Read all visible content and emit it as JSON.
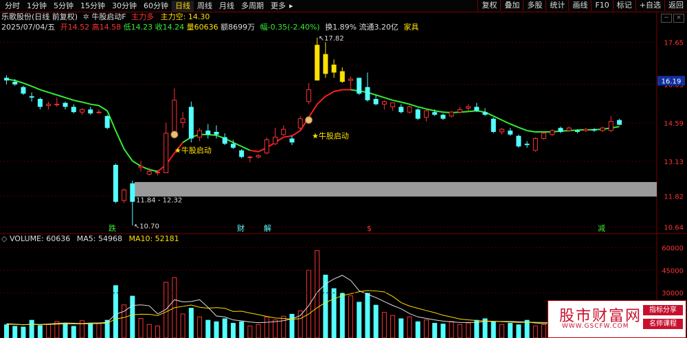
{
  "toolbar": {
    "periods": [
      "分时",
      "1分钟",
      "5分钟",
      "15分钟",
      "30分钟",
      "60分钟",
      "日线",
      "周线",
      "月线",
      "多周期",
      "更多"
    ],
    "active_index": 6,
    "more_caret": "▸",
    "right_buttons": [
      "复权",
      "叠加",
      "多股",
      "统计",
      "画线",
      "F10",
      "标记",
      "+自选",
      "返回"
    ]
  },
  "header": {
    "stock_name": "乐歌股份(日线 前复权)",
    "indicator_name": "牛股启动F",
    "zlduo": "主力多",
    "zlkong": "主力空: 14.30"
  },
  "quote": {
    "date": "2025/07/04/五",
    "open": "开14.52",
    "high": "高14.58",
    "low": "低14.23",
    "close": "收14.24",
    "volume": "量60636",
    "amount": "额8699万",
    "change": "幅-0.35(-2.40%)",
    "turnover": "换1.89%",
    "float_cap": "流通3.20亿",
    "sector": "家具"
  },
  "price_axis": [
    "17.65",
    "16.05",
    "14.59",
    "13.13",
    "11.82",
    "10.64"
  ],
  "current_price_tag": "16.19",
  "annotations": {
    "high_label": "17.82",
    "low_label": "10.70",
    "range_label": "11.84 - 12.32",
    "signal_1": "★牛股启动",
    "signal_2": "★牛股启动",
    "event_1": "跌",
    "event_2": "财",
    "event_3": "解",
    "event_4": "$",
    "event_5": "减"
  },
  "volume": {
    "label": "VOLUME: 60636",
    "ma5": "MA5: 54968",
    "ma10": "MA10: 52181",
    "axis": [
      "60000",
      "45000",
      "30000"
    ]
  },
  "colors": {
    "up": "#ff3333",
    "down": "#54ffff",
    "ma_green": "#33ee33",
    "ma_red": "#ff2020",
    "yellow": "#ffe000",
    "grey_band": "#9a9a9a"
  },
  "watermark": {
    "title": "股市财富网",
    "url": "WWW.GSCFW.COM",
    "tag1": "指标分享",
    "tag2": "名师课程"
  },
  "chart_data": {
    "type": "candlestick",
    "ylim": [
      10.5,
      18.0
    ],
    "candles": [
      {
        "o": 16.3,
        "h": 16.4,
        "l": 16.05,
        "c": 16.2
      },
      {
        "o": 16.15,
        "h": 16.25,
        "l": 16.0,
        "c": 16.05
      },
      {
        "o": 15.95,
        "h": 16.0,
        "l": 15.65,
        "c": 15.7
      },
      {
        "o": 15.6,
        "h": 15.75,
        "l": 15.4,
        "c": 15.55
      },
      {
        "o": 15.5,
        "h": 15.55,
        "l": 15.1,
        "c": 15.2
      },
      {
        "o": 15.25,
        "h": 15.4,
        "l": 15.1,
        "c": 15.3
      },
      {
        "o": 15.3,
        "h": 15.55,
        "l": 15.2,
        "c": 15.3
      },
      {
        "o": 15.35,
        "h": 15.4,
        "l": 15.1,
        "c": 15.2
      },
      {
        "o": 15.2,
        "h": 15.3,
        "l": 14.95,
        "c": 15.0
      },
      {
        "o": 15.0,
        "h": 15.15,
        "l": 14.9,
        "c": 15.1
      },
      {
        "o": 15.1,
        "h": 15.2,
        "l": 14.9,
        "c": 14.95
      },
      {
        "o": 15.0,
        "h": 15.1,
        "l": 14.95,
        "c": 15.0
      },
      {
        "o": 14.85,
        "h": 14.9,
        "l": 14.35,
        "c": 14.4
      },
      {
        "o": 13.0,
        "h": 13.05,
        "l": 11.55,
        "c": 11.6
      },
      {
        "o": 11.65,
        "h": 12.1,
        "l": 11.55,
        "c": 12.05
      },
      {
        "o": 12.3,
        "h": 12.4,
        "l": 10.7,
        "c": 11.6
      },
      {
        "o": 12.9,
        "h": 13.15,
        "l": 12.75,
        "c": 12.95
      },
      {
        "o": 12.65,
        "h": 12.9,
        "l": 12.6,
        "c": 12.75
      },
      {
        "o": 12.7,
        "h": 12.8,
        "l": 12.6,
        "c": 12.72
      },
      {
        "o": 12.7,
        "h": 14.6,
        "l": 12.7,
        "c": 14.2
      },
      {
        "o": 14.2,
        "h": 15.9,
        "l": 14.1,
        "c": 15.45
      },
      {
        "o": 14.6,
        "h": 15.0,
        "l": 14.4,
        "c": 14.75
      },
      {
        "o": 15.2,
        "h": 15.4,
        "l": 13.85,
        "c": 14.0
      },
      {
        "o": 14.05,
        "h": 14.4,
        "l": 13.9,
        "c": 14.3
      },
      {
        "o": 14.3,
        "h": 14.55,
        "l": 14.0,
        "c": 14.15
      },
      {
        "o": 14.25,
        "h": 14.5,
        "l": 14.0,
        "c": 14.15
      },
      {
        "o": 14.05,
        "h": 14.2,
        "l": 13.75,
        "c": 13.8
      },
      {
        "o": 13.8,
        "h": 13.95,
        "l": 13.6,
        "c": 13.65
      },
      {
        "o": 13.55,
        "h": 13.6,
        "l": 13.25,
        "c": 13.3
      },
      {
        "o": 13.3,
        "h": 13.35,
        "l": 13.1,
        "c": 13.3
      },
      {
        "o": 13.3,
        "h": 13.4,
        "l": 13.25,
        "c": 13.35
      },
      {
        "o": 13.45,
        "h": 14.05,
        "l": 13.4,
        "c": 13.95
      },
      {
        "o": 13.8,
        "h": 14.4,
        "l": 13.75,
        "c": 14.05
      },
      {
        "o": 14.15,
        "h": 14.5,
        "l": 14.1,
        "c": 14.35
      },
      {
        "o": 14.0,
        "h": 14.1,
        "l": 13.75,
        "c": 13.85
      },
      {
        "o": 14.4,
        "h": 14.85,
        "l": 14.3,
        "c": 14.75
      },
      {
        "o": 15.4,
        "h": 16.1,
        "l": 15.3,
        "c": 15.85
      },
      {
        "o": 16.2,
        "h": 17.82,
        "l": 16.2,
        "c": 17.55
      },
      {
        "o": 17.2,
        "h": 17.65,
        "l": 16.3,
        "c": 16.45
      },
      {
        "o": 16.8,
        "h": 17.0,
        "l": 16.3,
        "c": 16.5
      },
      {
        "o": 16.55,
        "h": 16.7,
        "l": 16.1,
        "c": 16.15
      },
      {
        "o": 16.2,
        "h": 16.35,
        "l": 15.85,
        "c": 16.25
      },
      {
        "o": 16.3,
        "h": 16.3,
        "l": 15.65,
        "c": 15.7
      },
      {
        "o": 15.95,
        "h": 16.5,
        "l": 15.4,
        "c": 15.45
      },
      {
        "o": 15.5,
        "h": 15.65,
        "l": 15.25,
        "c": 15.3
      },
      {
        "o": 15.3,
        "h": 15.45,
        "l": 15.1,
        "c": 15.4
      },
      {
        "o": 15.2,
        "h": 15.35,
        "l": 15.05,
        "c": 15.35
      },
      {
        "o": 15.2,
        "h": 15.3,
        "l": 14.95,
        "c": 15.0
      },
      {
        "o": 15.0,
        "h": 15.25,
        "l": 14.95,
        "c": 15.2
      },
      {
        "o": 15.1,
        "h": 15.15,
        "l": 14.7,
        "c": 14.75
      },
      {
        "o": 14.8,
        "h": 15.1,
        "l": 14.65,
        "c": 15.05
      },
      {
        "o": 15.0,
        "h": 15.1,
        "l": 14.85,
        "c": 14.9
      },
      {
        "o": 14.9,
        "h": 14.95,
        "l": 14.7,
        "c": 14.75
      },
      {
        "o": 14.85,
        "h": 15.05,
        "l": 14.8,
        "c": 15.0
      },
      {
        "o": 15.0,
        "h": 15.2,
        "l": 14.95,
        "c": 15.1
      },
      {
        "o": 15.15,
        "h": 15.3,
        "l": 15.05,
        "c": 15.2
      },
      {
        "o": 15.2,
        "h": 15.35,
        "l": 15.0,
        "c": 15.05
      },
      {
        "o": 15.0,
        "h": 15.15,
        "l": 14.85,
        "c": 14.9
      },
      {
        "o": 14.75,
        "h": 14.8,
        "l": 14.2,
        "c": 14.25
      },
      {
        "o": 14.25,
        "h": 14.4,
        "l": 14.15,
        "c": 14.35
      },
      {
        "o": 14.3,
        "h": 14.4,
        "l": 14.1,
        "c": 14.15
      },
      {
        "o": 14.1,
        "h": 14.15,
        "l": 13.65,
        "c": 13.7
      },
      {
        "o": 13.8,
        "h": 13.9,
        "l": 13.65,
        "c": 13.75
      },
      {
        "o": 13.55,
        "h": 14.05,
        "l": 13.5,
        "c": 14.0
      },
      {
        "o": 14.0,
        "h": 14.25,
        "l": 13.95,
        "c": 14.2
      },
      {
        "o": 14.15,
        "h": 14.35,
        "l": 14.1,
        "c": 14.3
      },
      {
        "o": 14.4,
        "h": 14.45,
        "l": 14.2,
        "c": 14.25
      },
      {
        "o": 14.3,
        "h": 14.45,
        "l": 14.25,
        "c": 14.4
      },
      {
        "o": 14.3,
        "h": 14.35,
        "l": 14.2,
        "c": 14.25
      },
      {
        "o": 14.3,
        "h": 14.4,
        "l": 14.25,
        "c": 14.35
      },
      {
        "o": 14.35,
        "h": 14.4,
        "l": 14.25,
        "c": 14.3
      },
      {
        "o": 14.3,
        "h": 14.45,
        "l": 14.25,
        "c": 14.4
      },
      {
        "o": 14.3,
        "h": 14.85,
        "l": 14.25,
        "c": 14.65
      },
      {
        "o": 14.7,
        "h": 14.75,
        "l": 14.5,
        "c": 14.52
      }
    ],
    "ma_line": [
      16.25,
      16.2,
      16.1,
      15.98,
      15.85,
      15.75,
      15.65,
      15.55,
      15.45,
      15.38,
      15.3,
      15.25,
      15.05,
      14.3,
      13.6,
      13.15,
      12.95,
      12.82,
      12.75,
      13.0,
      13.45,
      13.85,
      14.05,
      14.15,
      14.15,
      14.12,
      14.0,
      13.85,
      13.7,
      13.55,
      13.5,
      13.65,
      13.85,
      14.05,
      14.1,
      14.3,
      14.8,
      15.3,
      15.6,
      15.78,
      15.85,
      15.85,
      15.8,
      15.75,
      15.65,
      15.55,
      15.45,
      15.38,
      15.3,
      15.2,
      15.12,
      15.05,
      15.0,
      14.98,
      15.0,
      15.02,
      15.05,
      15.0,
      14.85,
      14.7,
      14.55,
      14.42,
      14.3,
      14.25,
      14.25,
      14.25,
      14.28,
      14.3,
      14.32,
      14.33,
      14.33,
      14.35,
      14.4,
      14.45
    ],
    "ma_color_flags": [
      0,
      0,
      0,
      0,
      0,
      0,
      0,
      0,
      0,
      0,
      0,
      0,
      0,
      0,
      0,
      0,
      0,
      0,
      0,
      1,
      1,
      1,
      0,
      0,
      0,
      0,
      0,
      0,
      0,
      0,
      1,
      1,
      1,
      1,
      1,
      1,
      1,
      1,
      1,
      1,
      1,
      1,
      0,
      0,
      0,
      0,
      0,
      0,
      0,
      0,
      0,
      0,
      0,
      0,
      0,
      0,
      0,
      0,
      0,
      0,
      0,
      0,
      0,
      0,
      0,
      0,
      0,
      0,
      0,
      0,
      0,
      0,
      0,
      0
    ],
    "volumes": [
      9000,
      8000,
      7500,
      12000,
      8500,
      9000,
      11000,
      10000,
      8000,
      11500,
      9500,
      10000,
      12000,
      35000,
      22000,
      28000,
      13000,
      9000,
      8000,
      37000,
      40000,
      16000,
      20000,
      14000,
      12000,
      11000,
      13000,
      10000,
      11000,
      8000,
      9000,
      14000,
      12000,
      14500,
      16000,
      18000,
      45000,
      58000,
      42000,
      33000,
      30000,
      28000,
      24000,
      30000,
      22000,
      17000,
      15000,
      13000,
      14000,
      11000,
      12000,
      10000,
      9500,
      11000,
      9000,
      10000,
      12000,
      13000,
      11000,
      9000,
      10000,
      9000,
      12000,
      8000,
      9000,
      10000,
      9000,
      8500,
      9000,
      10000,
      9500,
      11000,
      12000,
      10000
    ],
    "vol_ma5": [
      9500,
      9200,
      8800,
      9200,
      9000,
      9300,
      9700,
      10000,
      9800,
      9600,
      10000,
      10000,
      10400,
      15800,
      17700,
      21600,
      22000,
      21400,
      16000,
      19000,
      25400,
      24000,
      24200,
      25400,
      20400,
      14600,
      14000,
      12000,
      11400,
      10600,
      10200,
      10400,
      10800,
      11500,
      12700,
      14900,
      21500,
      30300,
      35900,
      39200,
      41600,
      38200,
      31400,
      29000,
      26800,
      24200,
      21600,
      19400,
      16200,
      14000,
      13000,
      12000,
      11200,
      10700,
      10300,
      10300,
      10300,
      11000,
      11000,
      11000,
      11000,
      10800,
      10600,
      10000,
      9600,
      9600,
      9600,
      9100,
      9300,
      9300,
      9400,
      9600,
      10300,
      10500
    ],
    "vol_ma10": [
      9200,
      9000,
      8900,
      9000,
      8900,
      9000,
      9200,
      9400,
      9400,
      9400,
      9500,
      9600,
      9900,
      12600,
      13600,
      15400,
      15800,
      15700,
      14900,
      17300,
      20100,
      21000,
      21900,
      20400,
      19800,
      20200,
      19700,
      17600,
      17800,
      16600,
      15500,
      14300,
      13300,
      13000,
      12500,
      12800,
      15900,
      20100,
      23600,
      25900,
      28200,
      29300,
      30700,
      31500,
      31200,
      30600,
      27600,
      23500,
      21200,
      19700,
      18200,
      16800,
      15100,
      13900,
      12600,
      12000,
      11600,
      11300,
      11100,
      10800,
      10600,
      10300,
      10500,
      10400,
      10300,
      10300,
      10300,
      10100,
      10200,
      10100,
      10200,
      10200,
      10300,
      10200
    ]
  }
}
